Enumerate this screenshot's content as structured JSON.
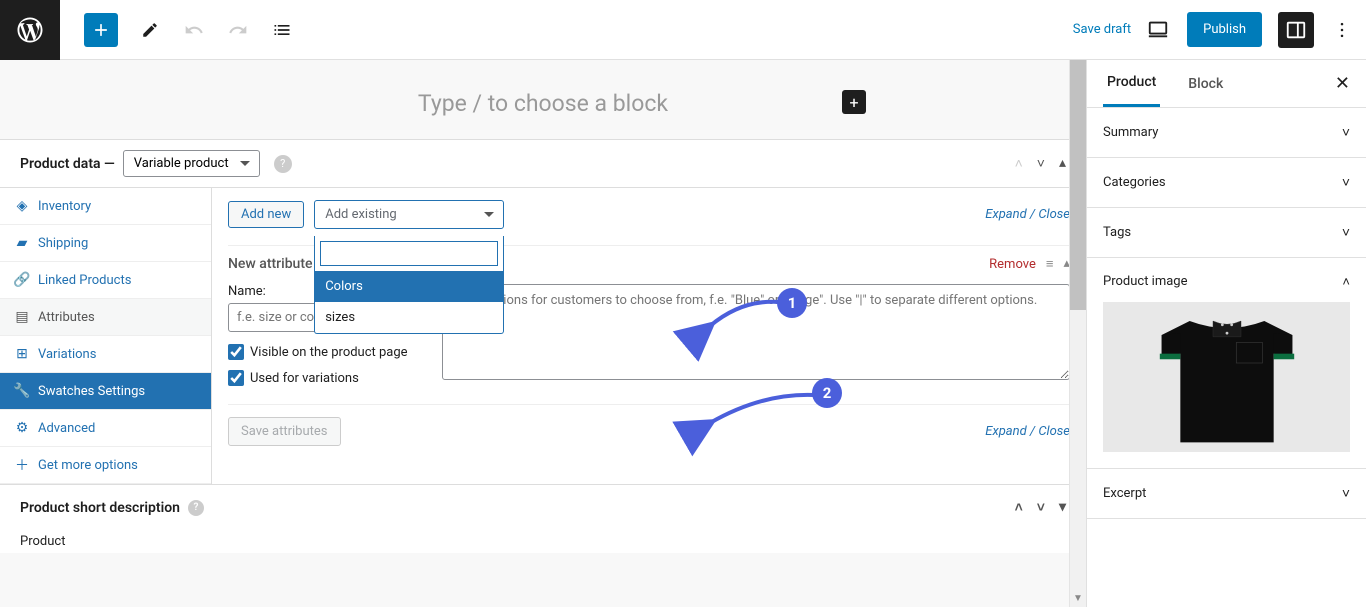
{
  "topbar": {
    "save_draft": "Save draft",
    "publish": "Publish"
  },
  "title_placeholder": "Type / to choose a block",
  "product_data": {
    "label": "Product data —",
    "type_select": "Variable product",
    "tabs": {
      "inventory": "Inventory",
      "shipping": "Shipping",
      "linked": "Linked Products",
      "attributes": "Attributes",
      "variations": "Variations",
      "swatches": "Swatches Settings",
      "advanced": "Advanced",
      "more": "Get more options"
    }
  },
  "attr_panel": {
    "add_new": "Add new",
    "add_existing": "Add existing",
    "expand": "Expand / Close",
    "new_attribute": "New attribute",
    "remove": "Remove",
    "name_label": "Name:",
    "name_placeholder": "f.e. size or color",
    "values_placeholder": "Enter options for customers to choose from, f.e. \"Blue\" or \"Large\". Use \"|\" to separate different options.",
    "visible": "Visible on the product page",
    "used_variations": "Used for variations",
    "save": "Save attributes",
    "dropdown": {
      "option1": "Colors",
      "option2": "sizes"
    }
  },
  "short_desc": "Product short description",
  "footer_text": "Product",
  "right_sidebar": {
    "tab_product": "Product",
    "tab_block": "Block",
    "panels": {
      "summary": "Summary",
      "categories": "Categories",
      "tags": "Tags",
      "product_image": "Product image",
      "excerpt": "Excerpt"
    }
  },
  "callouts": {
    "c1": "1",
    "c2": "2"
  }
}
